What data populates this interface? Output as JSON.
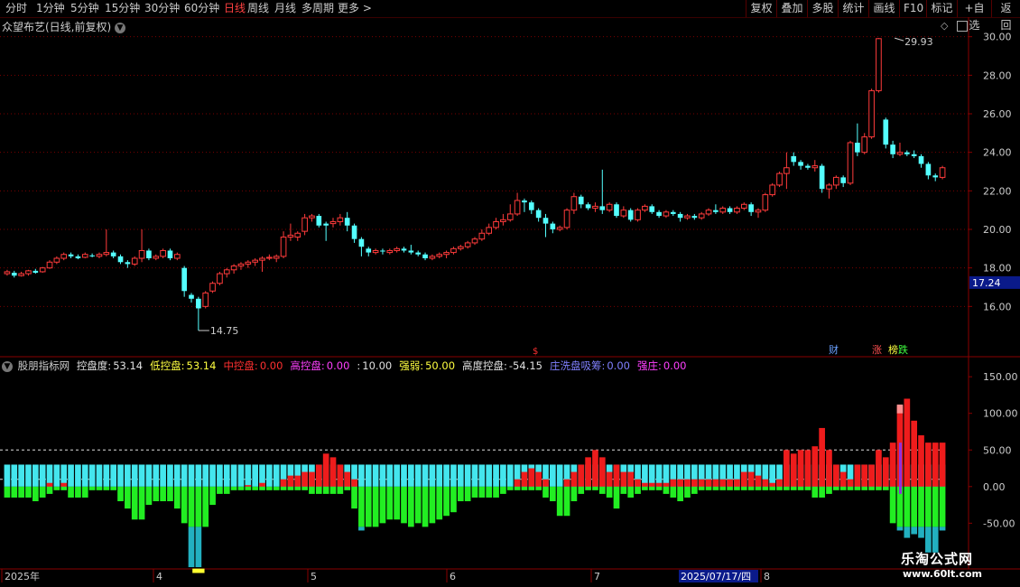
{
  "toolbar": {
    "periods": [
      "分时",
      "1分钟",
      "5分钟",
      "15分钟",
      "30分钟",
      "60分钟",
      "日线",
      "周线",
      "月线",
      "多周期",
      "更多 >"
    ],
    "active_period": "日线",
    "right_buttons": [
      "复权",
      "叠加",
      "多股",
      "统计",
      "画线",
      "F10",
      "标记",
      "+自选",
      "返回"
    ]
  },
  "main_chart": {
    "title": "众望布艺(日线,前复权)",
    "price_labels": [
      "30.00",
      "28.00",
      "26.00",
      "24.00",
      "22.00",
      "20.00",
      "18.00",
      "16.00"
    ],
    "current_price": "17.24",
    "high_label": "29.93",
    "low_label": "14.75",
    "markers": {
      "cai": "财",
      "zhang": "涨",
      "bang": "榜",
      "die": "跌"
    }
  },
  "indicator": {
    "name": "股朋指标网",
    "items": [
      {
        "label": "控盘度:",
        "value": "53.14",
        "color": "#e0e0e0"
      },
      {
        "label": "低控盘:",
        "value": "53.14",
        "color": "#ffff40"
      },
      {
        "label": "中控盘:",
        "value": "0.00",
        "color": "#ff3030"
      },
      {
        "label": "高控盘:",
        "value": "0.00",
        "color": "#ff40ff"
      },
      {
        "label": ":",
        "value": "10.00",
        "color": "#e0e0e0"
      },
      {
        "label": "强弱:",
        "value": "50.00",
        "color": "#ffff40"
      },
      {
        "label": "高度控盘:",
        "value": "-54.15",
        "color": "#e0e0e0"
      },
      {
        "label": "庄洗盘吸筹:",
        "value": "0.00",
        "color": "#8080ff"
      },
      {
        "label": "强庄:",
        "value": "0.00",
        "color": "#ff40ff"
      }
    ],
    "axis_labels": [
      "150.00",
      "100.00",
      "50.00",
      "0.00",
      "-50.00"
    ]
  },
  "time_axis": {
    "labels": [
      "2025年",
      "4",
      "5",
      "6",
      "7",
      "8"
    ],
    "cursor_date": "2025/07/17/四"
  },
  "watermark": {
    "line1": "乐淘公式网",
    "line2": "www.60lt.com"
  },
  "chart_data": {
    "type": "candlestick",
    "title": "众望布艺(日线,前复权)",
    "ylim": [
      14,
      30.5
    ],
    "candles": [
      [
        17.7,
        17.8,
        17.6,
        17.9
      ],
      [
        17.75,
        17.6,
        17.5,
        17.85
      ],
      [
        17.6,
        17.7,
        17.55,
        17.8
      ],
      [
        17.7,
        17.85,
        17.6,
        17.9
      ],
      [
        17.85,
        17.75,
        17.7,
        17.95
      ],
      [
        17.8,
        18.0,
        17.75,
        18.05
      ],
      [
        18.0,
        18.3,
        17.95,
        18.4
      ],
      [
        18.3,
        18.5,
        18.2,
        18.6
      ],
      [
        18.5,
        18.7,
        18.4,
        18.8
      ],
      [
        18.7,
        18.6,
        18.5,
        18.8
      ],
      [
        18.6,
        18.5,
        18.45,
        18.7
      ],
      [
        18.55,
        18.7,
        18.5,
        18.8
      ],
      [
        18.65,
        18.6,
        18.55,
        18.75
      ],
      [
        18.6,
        18.7,
        18.5,
        18.8
      ],
      [
        18.7,
        18.8,
        18.6,
        20.0
      ],
      [
        18.8,
        18.6,
        18.5,
        18.9
      ],
      [
        18.6,
        18.3,
        18.2,
        18.7
      ],
      [
        18.3,
        18.2,
        18.0,
        18.4
      ],
      [
        18.2,
        18.5,
        18.1,
        18.6
      ],
      [
        18.5,
        18.9,
        18.3,
        20.0
      ],
      [
        18.9,
        18.5,
        18.4,
        19.0
      ],
      [
        18.5,
        18.6,
        18.4,
        18.7
      ],
      [
        18.6,
        18.9,
        18.5,
        19.0
      ],
      [
        18.9,
        18.5,
        18.4,
        19.0
      ],
      [
        18.5,
        18.7,
        18.4,
        18.8
      ],
      [
        18.0,
        16.8,
        16.5,
        18.1
      ],
      [
        16.6,
        16.4,
        16.2,
        16.7
      ],
      [
        16.4,
        15.9,
        14.75,
        16.5
      ],
      [
        16.0,
        16.7,
        15.9,
        16.8
      ],
      [
        16.8,
        17.2,
        16.7,
        17.3
      ],
      [
        17.2,
        17.7,
        17.1,
        17.8
      ],
      [
        17.7,
        17.9,
        17.5,
        18.0
      ],
      [
        17.9,
        18.1,
        17.7,
        18.2
      ],
      [
        18.1,
        18.2,
        17.9,
        18.3
      ],
      [
        18.2,
        18.3,
        18.0,
        18.4
      ],
      [
        18.3,
        18.4,
        18.1,
        18.5
      ],
      [
        18.4,
        18.5,
        17.8,
        18.6
      ],
      [
        18.5,
        18.55,
        18.4,
        18.7
      ],
      [
        18.5,
        18.6,
        18.3,
        18.7
      ],
      [
        18.6,
        19.6,
        18.5,
        19.9
      ],
      [
        19.6,
        19.7,
        19.4,
        20.3
      ],
      [
        19.6,
        19.8,
        19.4,
        19.9
      ],
      [
        19.9,
        20.6,
        19.7,
        20.8
      ],
      [
        20.6,
        20.7,
        20.4,
        20.8
      ],
      [
        20.7,
        20.2,
        20.1,
        20.8
      ],
      [
        20.3,
        20.2,
        19.4,
        20.4
      ],
      [
        20.3,
        20.4,
        20.1,
        20.6
      ],
      [
        20.4,
        20.6,
        20.2,
        20.8
      ],
      [
        20.6,
        20.2,
        19.9,
        20.9
      ],
      [
        20.2,
        19.5,
        19.3,
        20.3
      ],
      [
        19.5,
        19.1,
        18.6,
        19.6
      ],
      [
        19.0,
        18.8,
        18.6,
        19.1
      ],
      [
        18.8,
        18.9,
        18.7,
        19.0
      ],
      [
        18.9,
        18.85,
        18.7,
        19.0
      ],
      [
        18.8,
        18.9,
        18.7,
        19.0
      ],
      [
        18.9,
        19.0,
        18.8,
        19.1
      ],
      [
        19.0,
        18.9,
        18.8,
        19.1
      ],
      [
        18.9,
        18.8,
        18.7,
        19.2
      ],
      [
        18.8,
        18.7,
        18.6,
        18.9
      ],
      [
        18.7,
        18.5,
        18.4,
        18.8
      ],
      [
        18.5,
        18.6,
        18.4,
        18.7
      ],
      [
        18.6,
        18.7,
        18.5,
        18.8
      ],
      [
        18.7,
        18.8,
        18.5,
        18.9
      ],
      [
        18.8,
        19.0,
        18.7,
        19.1
      ],
      [
        19.0,
        19.1,
        18.9,
        19.2
      ],
      [
        19.1,
        19.3,
        19.0,
        19.4
      ],
      [
        19.3,
        19.5,
        19.2,
        19.6
      ],
      [
        19.5,
        19.8,
        19.4,
        20.0
      ],
      [
        19.8,
        20.1,
        19.7,
        20.3
      ],
      [
        20.1,
        20.4,
        20.0,
        20.6
      ],
      [
        20.4,
        20.5,
        20.2,
        20.8
      ],
      [
        20.5,
        20.8,
        20.4,
        21.3
      ],
      [
        20.8,
        21.5,
        20.7,
        21.9
      ],
      [
        21.5,
        21.4,
        20.9,
        21.6
      ],
      [
        21.4,
        21.0,
        20.8,
        21.5
      ],
      [
        21.0,
        20.6,
        20.4,
        21.1
      ],
      [
        20.6,
        20.3,
        19.6,
        20.8
      ],
      [
        20.3,
        20.0,
        19.8,
        20.4
      ],
      [
        20.0,
        20.1,
        19.9,
        20.2
      ],
      [
        20.1,
        21.0,
        20.0,
        21.1
      ],
      [
        21.0,
        21.7,
        20.8,
        21.9
      ],
      [
        21.7,
        21.3,
        21.1,
        21.8
      ],
      [
        21.3,
        21.1,
        21.0,
        21.4
      ],
      [
        21.1,
        21.2,
        20.9,
        21.4
      ],
      [
        21.2,
        21.0,
        20.8,
        23.1
      ],
      [
        21.0,
        21.3,
        20.9,
        21.4
      ],
      [
        21.3,
        20.7,
        20.6,
        21.4
      ],
      [
        20.7,
        21.0,
        20.6,
        21.2
      ],
      [
        21.0,
        20.5,
        20.4,
        21.1
      ],
      [
        20.5,
        21.0,
        20.4,
        21.1
      ],
      [
        21.0,
        21.2,
        20.9,
        21.3
      ],
      [
        21.2,
        20.9,
        20.8,
        21.3
      ],
      [
        20.9,
        20.7,
        20.6,
        21.0
      ],
      [
        20.7,
        20.9,
        20.6,
        21.0
      ],
      [
        20.9,
        20.8,
        20.7,
        21.0
      ],
      [
        20.8,
        20.6,
        20.4,
        20.9
      ],
      [
        20.6,
        20.7,
        20.5,
        20.8
      ],
      [
        20.7,
        20.6,
        20.5,
        20.8
      ],
      [
        20.6,
        20.8,
        20.5,
        20.9
      ],
      [
        20.8,
        21.0,
        20.7,
        21.1
      ],
      [
        21.0,
        20.9,
        20.8,
        21.3
      ],
      [
        20.9,
        21.1,
        20.8,
        21.2
      ],
      [
        21.1,
        20.9,
        20.8,
        21.2
      ],
      [
        20.9,
        21.1,
        20.8,
        21.2
      ],
      [
        21.1,
        21.3,
        21.0,
        21.4
      ],
      [
        21.3,
        20.9,
        20.7,
        21.4
      ],
      [
        20.9,
        21.0,
        20.6,
        21.1
      ],
      [
        21.0,
        21.8,
        20.9,
        21.9
      ],
      [
        21.8,
        22.3,
        21.7,
        22.4
      ],
      [
        22.3,
        22.9,
        22.2,
        23.0
      ],
      [
        22.9,
        23.2,
        22.1,
        24.0
      ],
      [
        23.8,
        23.5,
        23.3,
        24.0
      ],
      [
        23.5,
        23.3,
        23.1,
        23.6
      ],
      [
        23.3,
        23.2,
        23.1,
        23.4
      ],
      [
        23.2,
        23.3,
        23.0,
        23.6
      ],
      [
        23.3,
        22.1,
        21.9,
        23.4
      ],
      [
        22.1,
        22.3,
        21.6,
        22.4
      ],
      [
        22.3,
        22.7,
        22.1,
        22.8
      ],
      [
        22.7,
        22.4,
        22.2,
        22.8
      ],
      [
        22.4,
        24.5,
        22.3,
        24.6
      ],
      [
        24.5,
        24.0,
        23.8,
        25.5
      ],
      [
        24.0,
        24.8,
        23.9,
        25.0
      ],
      [
        24.8,
        27.2,
        24.7,
        27.3
      ],
      [
        27.2,
        29.9,
        27.1,
        29.93
      ],
      [
        25.7,
        24.4,
        24.2,
        25.8
      ],
      [
        24.4,
        23.9,
        23.7,
        24.6
      ],
      [
        23.9,
        24.0,
        23.8,
        24.5
      ],
      [
        24.0,
        23.9,
        23.8,
        24.1
      ],
      [
        23.9,
        23.8,
        23.7,
        24.1
      ],
      [
        23.8,
        23.4,
        23.2,
        23.9
      ],
      [
        23.4,
        22.8,
        22.6,
        23.5
      ],
      [
        22.8,
        22.7,
        22.5,
        22.9
      ],
      [
        22.7,
        23.2,
        22.6,
        23.3
      ]
    ],
    "indicator_bars": [
      30,
      30,
      30,
      30,
      30,
      30,
      30,
      30,
      30,
      30,
      30,
      30,
      30,
      30,
      30,
      30,
      30,
      30,
      30,
      30,
      30,
      30,
      30,
      30,
      30,
      30,
      30,
      30,
      30,
      30,
      30,
      30,
      30,
      30,
      30,
      30,
      30,
      30,
      30,
      30,
      30,
      30,
      30,
      30,
      30,
      30,
      30,
      30,
      30,
      30,
      30,
      30,
      30,
      30,
      30,
      30,
      30,
      30,
      30,
      30,
      30,
      30,
      30,
      30,
      30,
      30,
      30,
      30,
      30,
      30,
      30,
      30,
      30,
      30,
      30,
      30,
      30,
      30,
      30,
      30,
      30,
      30,
      30,
      30,
      30,
      30,
      30,
      30,
      30,
      30,
      30,
      30,
      30,
      30,
      30,
      30,
      30,
      30,
      30,
      30,
      30,
      30,
      30,
      30,
      30,
      30,
      30,
      30,
      30,
      30,
      30,
      30,
      30,
      30,
      30,
      30,
      30,
      30,
      30,
      30,
      30,
      30,
      30,
      30,
      30,
      30,
      30,
      30,
      30,
      30,
      30,
      30,
      30,
      30,
      30
    ],
    "red_bars": [
      0,
      0,
      0,
      0,
      0,
      0,
      5,
      0,
      5,
      0,
      0,
      0,
      0,
      0,
      0,
      0,
      0,
      0,
      0,
      0,
      0,
      0,
      0,
      0,
      0,
      0,
      0,
      0,
      0,
      0,
      0,
      0,
      0,
      0,
      2,
      0,
      5,
      0,
      0,
      10,
      15,
      15,
      20,
      20,
      30,
      45,
      40,
      30,
      20,
      10,
      0,
      0,
      0,
      0,
      0,
      0,
      0,
      0,
      0,
      0,
      0,
      0,
      0,
      0,
      0,
      0,
      0,
      0,
      0,
      0,
      0,
      0,
      10,
      20,
      25,
      20,
      10,
      0,
      0,
      10,
      20,
      30,
      40,
      50,
      40,
      20,
      30,
      20,
      20,
      10,
      5,
      5,
      5,
      5,
      10,
      10,
      10,
      10,
      10,
      10,
      10,
      10,
      10,
      10,
      20,
      20,
      15,
      10,
      5,
      10,
      50,
      45,
      50,
      50,
      55,
      80,
      50,
      30,
      20,
      10,
      30,
      30,
      30,
      50,
      40,
      60,
      110,
      120,
      90,
      70,
      60,
      60,
      60,
      60,
      60,
      60,
      60
    ],
    "green_bars": [
      -15,
      -15,
      -15,
      -15,
      -20,
      -15,
      -10,
      -5,
      -5,
      -15,
      -15,
      -15,
      -5,
      -5,
      -5,
      -5,
      -20,
      -30,
      -45,
      -45,
      -25,
      -20,
      -20,
      -20,
      -30,
      -50,
      -110,
      -110,
      -55,
      -25,
      -10,
      -10,
      -5,
      -5,
      -5,
      -5,
      -5,
      -5,
      -5,
      -5,
      -5,
      -5,
      -5,
      -10,
      -10,
      -10,
      -10,
      -10,
      -5,
      -30,
      -60,
      -55,
      -55,
      -50,
      -45,
      -45,
      -50,
      -55,
      -50,
      -55,
      -50,
      -45,
      -40,
      -35,
      -20,
      -20,
      -15,
      -15,
      -15,
      -15,
      -10,
      -5,
      -5,
      -5,
      -5,
      -5,
      -15,
      -20,
      -40,
      -40,
      -20,
      -10,
      -5,
      -5,
      -10,
      -15,
      -30,
      -10,
      -15,
      -10,
      -5,
      -5,
      -5,
      -10,
      -15,
      -20,
      -15,
      -10,
      -5,
      -5,
      -5,
      -5,
      -5,
      -5,
      -5,
      -5,
      -5,
      -5,
      -5,
      -5,
      -5,
      -5,
      -5,
      -5,
      -15,
      -15,
      -10,
      -5,
      -5,
      -5,
      -5,
      -5,
      -5,
      -5,
      -5,
      -50,
      -60,
      -70,
      -65,
      -70,
      -90,
      -90,
      -60
    ]
  }
}
